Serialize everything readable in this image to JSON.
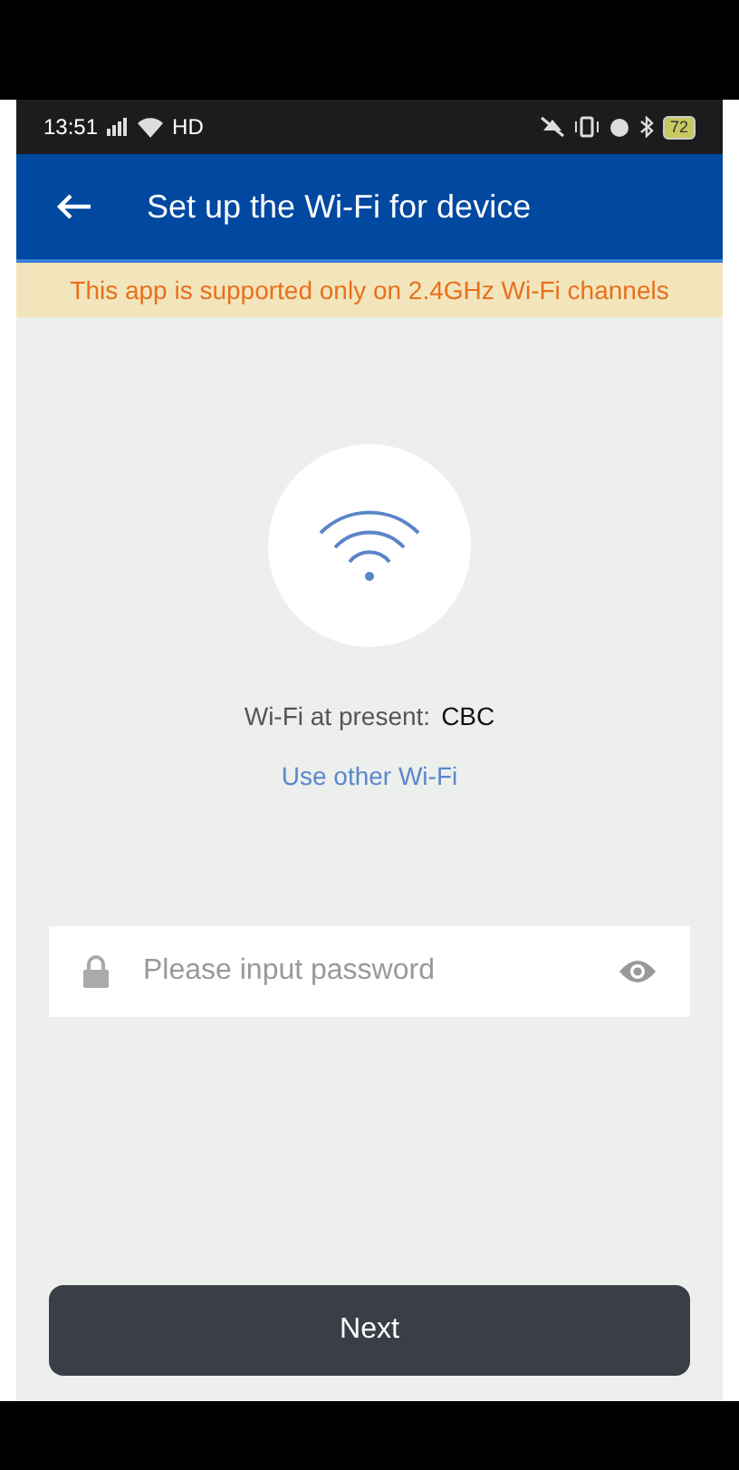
{
  "status_bar": {
    "time": "13:51",
    "network": "HD",
    "battery": "72"
  },
  "app_bar": {
    "title": "Set up the Wi-Fi for device"
  },
  "notice": "This app is supported only on 2.4GHz Wi-Fi channels",
  "current_wifi": {
    "label": "Wi-Fi at present:",
    "name": "CBC"
  },
  "other_wifi_link": "Use other Wi-Fi",
  "password_field": {
    "placeholder": "Please input password"
  },
  "next_button": "Next"
}
